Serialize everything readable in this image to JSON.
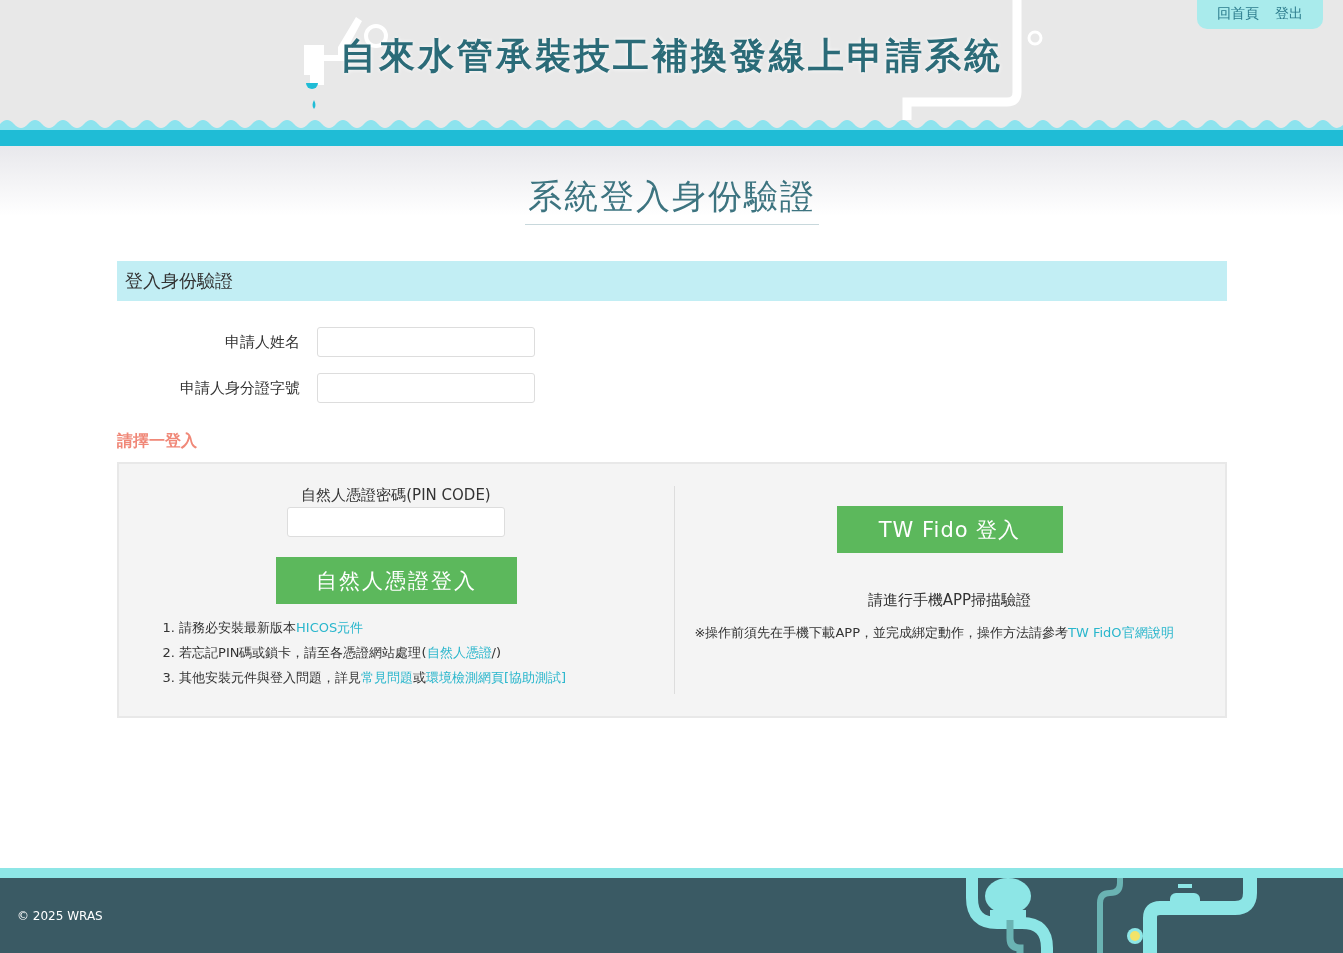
{
  "header": {
    "title": "自來水管承裝技工補換發線上申請系統",
    "nav_links": [
      "回首頁",
      "登出"
    ]
  },
  "page_heading": "系統登入身份驗證",
  "login_section": {
    "title": "登入身份驗證",
    "fields": [
      {
        "label": "申請人姓名"
      },
      {
        "label": "申請人身分證字號"
      }
    ]
  },
  "choose_prompt": "請擇一登入",
  "certificate_panel": {
    "pin_label": "自然人憑證密碼(PIN CODE)",
    "login_button": "自然人憑證登入",
    "notes": [
      {
        "number": "1.",
        "parts": [
          {
            "kind": "text",
            "text": "請務必安裝最新版本"
          },
          {
            "kind": "link",
            "text": "HICOS元件"
          }
        ]
      },
      {
        "number": "2.",
        "parts": [
          {
            "kind": "text",
            "text": "若忘記PIN碼或鎖卡，請至各憑證網站處理("
          },
          {
            "kind": "link",
            "text": "自然人憑證"
          },
          {
            "kind": "text",
            "text": "/)"
          }
        ]
      },
      {
        "number": "3.",
        "parts": [
          {
            "kind": "text",
            "text": "其他安裝元件與登入問題，詳見"
          },
          {
            "kind": "link",
            "text": "常見問題"
          },
          {
            "kind": "text",
            "text": "或"
          },
          {
            "kind": "link",
            "text": "環境檢測網頁[協助測試]"
          }
        ]
      }
    ]
  },
  "fido_panel": {
    "login_button": "TW Fido 登入",
    "instruction": "請進行手機APP掃描驗證",
    "note": [
      {
        "kind": "text",
        "text": "※操作前須先在手機下載APP，並完成綁定動作，操作方法請參考"
      },
      {
        "kind": "link",
        "text": "TW FidO官網說明"
      }
    ]
  },
  "footer": {
    "copyright": "© 2025 WRAS"
  }
}
